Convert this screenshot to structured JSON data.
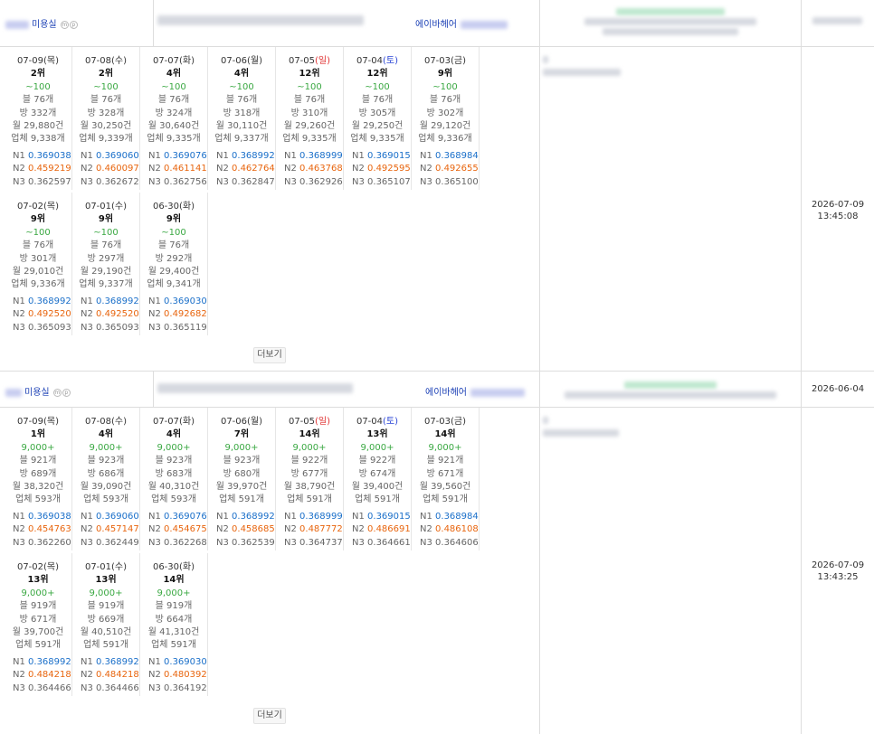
{
  "entries": [
    {
      "shop_label": "미용실",
      "brand_label": "에이바헤어",
      "badges": [
        "m",
        "p"
      ],
      "more_label": "더보기",
      "registered_date": "",
      "timestamp_date": "2026-07-09",
      "timestamp_time": "13:45:08",
      "days": [
        {
          "date": "07-09",
          "dow": "(목)",
          "dow_color": "",
          "rank": "2위",
          "price": "~100",
          "blog": "블 76개",
          "cafe": "방 332개",
          "monthly": "월 29,880건",
          "total": "업체 9,338개",
          "n1": "0.369038",
          "n2": "0.459219",
          "n3": "0.362597"
        },
        {
          "date": "07-08",
          "dow": "(수)",
          "dow_color": "",
          "rank": "2위",
          "price": "~100",
          "blog": "블 76개",
          "cafe": "방 328개",
          "monthly": "월 30,250건",
          "total": "업체 9,339개",
          "n1": "0.369060",
          "n2": "0.460097",
          "n3": "0.362672"
        },
        {
          "date": "07-07",
          "dow": "(화)",
          "dow_color": "",
          "rank": "4위",
          "price": "~100",
          "blog": "블 76개",
          "cafe": "방 324개",
          "monthly": "월 30,640건",
          "total": "업체 9,335개",
          "n1": "0.369076",
          "n2": "0.461141",
          "n3": "0.362756"
        },
        {
          "date": "07-06",
          "dow": "(월)",
          "dow_color": "",
          "rank": "4위",
          "price": "~100",
          "blog": "블 76개",
          "cafe": "방 318개",
          "monthly": "월 30,110건",
          "total": "업체 9,337개",
          "n1": "0.368992",
          "n2": "0.462764",
          "n3": "0.362847"
        },
        {
          "date": "07-05",
          "dow": "(일)",
          "dow_color": "red",
          "rank": "12위",
          "price": "~100",
          "blog": "블 76개",
          "cafe": "방 310개",
          "monthly": "월 29,260건",
          "total": "업체 9,335개",
          "n1": "0.368999",
          "n2": "0.463768",
          "n3": "0.362926"
        },
        {
          "date": "07-04",
          "dow": "(토)",
          "dow_color": "blue",
          "rank": "12위",
          "price": "~100",
          "blog": "블 76개",
          "cafe": "방 305개",
          "monthly": "월 29,250건",
          "total": "업체 9,335개",
          "n1": "0.369015",
          "n2": "0.492595",
          "n3": "0.365107"
        },
        {
          "date": "07-03",
          "dow": "(금)",
          "dow_color": "",
          "rank": "9위",
          "price": "~100",
          "blog": "블 76개",
          "cafe": "방 302개",
          "monthly": "월 29,120건",
          "total": "업체 9,336개",
          "n1": "0.368984",
          "n2": "0.492655",
          "n3": "0.365100"
        },
        {
          "date": "07-02",
          "dow": "(목)",
          "dow_color": "",
          "rank": "9위",
          "price": "~100",
          "blog": "블 76개",
          "cafe": "방 301개",
          "monthly": "월 29,010건",
          "total": "업체 9,336개",
          "n1": "0.368992",
          "n2": "0.492520",
          "n3": "0.365093"
        },
        {
          "date": "07-01",
          "dow": "(수)",
          "dow_color": "",
          "rank": "9위",
          "price": "~100",
          "blog": "블 76개",
          "cafe": "방 297개",
          "monthly": "월 29,190건",
          "total": "업체 9,337개",
          "n1": "0.368992",
          "n2": "0.492520",
          "n3": "0.365093"
        },
        {
          "date": "06-30",
          "dow": "(화)",
          "dow_color": "",
          "rank": "9위",
          "price": "~100",
          "blog": "블 76개",
          "cafe": "방 292개",
          "monthly": "월 29,400건",
          "total": "업체 9,341개",
          "n1": "0.369030",
          "n2": "0.492682",
          "n3": "0.365119"
        }
      ]
    },
    {
      "shop_label": "미용실",
      "brand_label": "에이바헤어",
      "badges": [
        "m",
        "p"
      ],
      "more_label": "더보기",
      "registered_date": "2026-06-04",
      "timestamp_date": "2026-07-09",
      "timestamp_time": "13:43:25",
      "days": [
        {
          "date": "07-09",
          "dow": "(목)",
          "dow_color": "",
          "rank": "1위",
          "price": "9,000+",
          "blog": "블 921개",
          "cafe": "방 689개",
          "monthly": "월 38,320건",
          "total": "업체 593개",
          "n1": "0.369038",
          "n2": "0.454763",
          "n3": "0.362260"
        },
        {
          "date": "07-08",
          "dow": "(수)",
          "dow_color": "",
          "rank": "4위",
          "price": "9,000+",
          "blog": "블 923개",
          "cafe": "방 686개",
          "monthly": "월 39,090건",
          "total": "업체 593개",
          "n1": "0.369060",
          "n2": "0.457147",
          "n3": "0.362449"
        },
        {
          "date": "07-07",
          "dow": "(화)",
          "dow_color": "",
          "rank": "4위",
          "price": "9,000+",
          "blog": "블 923개",
          "cafe": "방 683개",
          "monthly": "월 40,310건",
          "total": "업체 593개",
          "n1": "0.369076",
          "n2": "0.454675",
          "n3": "0.362268"
        },
        {
          "date": "07-06",
          "dow": "(월)",
          "dow_color": "",
          "rank": "7위",
          "price": "9,000+",
          "blog": "블 923개",
          "cafe": "방 680개",
          "monthly": "월 39,970건",
          "total": "업체 591개",
          "n1": "0.368992",
          "n2": "0.458685",
          "n3": "0.362539"
        },
        {
          "date": "07-05",
          "dow": "(일)",
          "dow_color": "red",
          "rank": "14위",
          "price": "9,000+",
          "blog": "블 922개",
          "cafe": "방 677개",
          "monthly": "월 38,790건",
          "total": "업체 591개",
          "n1": "0.368999",
          "n2": "0.487772",
          "n3": "0.364737"
        },
        {
          "date": "07-04",
          "dow": "(토)",
          "dow_color": "blue",
          "rank": "13위",
          "price": "9,000+",
          "blog": "블 922개",
          "cafe": "방 674개",
          "monthly": "월 39,400건",
          "total": "업체 591개",
          "n1": "0.369015",
          "n2": "0.486691",
          "n3": "0.364661"
        },
        {
          "date": "07-03",
          "dow": "(금)",
          "dow_color": "",
          "rank": "14위",
          "price": "9,000+",
          "blog": "블 921개",
          "cafe": "방 671개",
          "monthly": "월 39,560건",
          "total": "업체 591개",
          "n1": "0.368984",
          "n2": "0.486108",
          "n3": "0.364606"
        },
        {
          "date": "07-02",
          "dow": "(목)",
          "dow_color": "",
          "rank": "13위",
          "price": "9,000+",
          "blog": "블 919개",
          "cafe": "방 671개",
          "monthly": "월 39,700건",
          "total": "업체 591개",
          "n1": "0.368992",
          "n2": "0.484218",
          "n3": "0.364466"
        },
        {
          "date": "07-01",
          "dow": "(수)",
          "dow_color": "",
          "rank": "13위",
          "price": "9,000+",
          "blog": "블 919개",
          "cafe": "방 669개",
          "monthly": "월 40,510건",
          "total": "업체 591개",
          "n1": "0.368992",
          "n2": "0.484218",
          "n3": "0.364466"
        },
        {
          "date": "06-30",
          "dow": "(화)",
          "dow_color": "",
          "rank": "14위",
          "price": "9,000+",
          "blog": "블 919개",
          "cafe": "방 664개",
          "monthly": "월 41,310건",
          "total": "업체 591개",
          "n1": "0.369030",
          "n2": "0.480392",
          "n3": "0.364192"
        }
      ]
    }
  ],
  "labels": {
    "n1": "N1",
    "n2": "N2",
    "n3": "N3"
  },
  "colors": {
    "link": "#1a3fb5",
    "price": "#3aa842",
    "n1": "#1a6fc9",
    "n2": "#e8650e",
    "sunday": "#e03030",
    "saturday": "#2a45d6"
  }
}
